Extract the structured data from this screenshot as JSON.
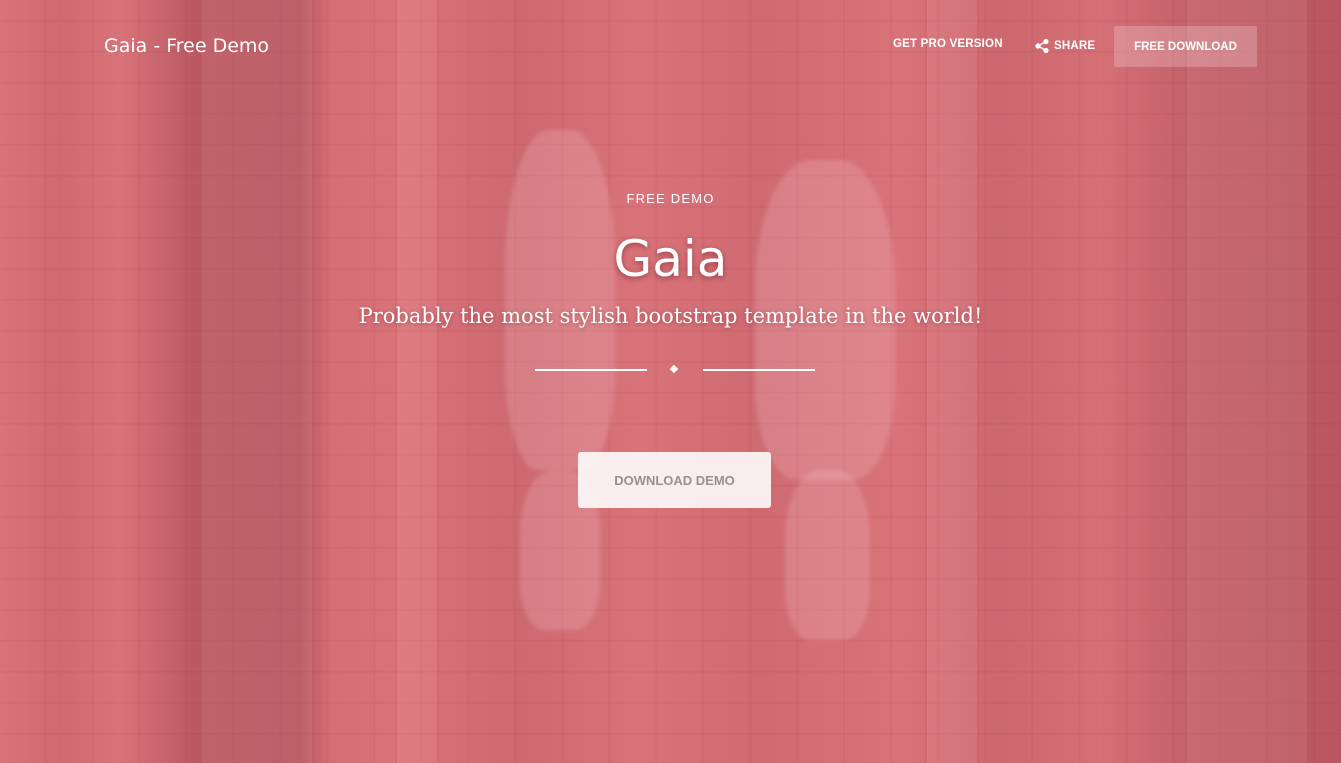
{
  "navbar": {
    "brand": "Gaia - Free Demo",
    "links": {
      "pro": "GET PRO VERSION",
      "share": "SHARE",
      "download": "FREE DOWNLOAD"
    }
  },
  "hero": {
    "kicker": "FREE DEMO",
    "title": "Gaia",
    "subtitle": "Probably the most stylish bootstrap template in the world!",
    "cta": "DOWNLOAD DEMO"
  },
  "icons": {
    "share": "share-icon",
    "separator": "diamond-icon"
  },
  "colors": {
    "overlay": "#d9737a",
    "text": "#ffffff",
    "cta_text": "#9a8e90"
  }
}
